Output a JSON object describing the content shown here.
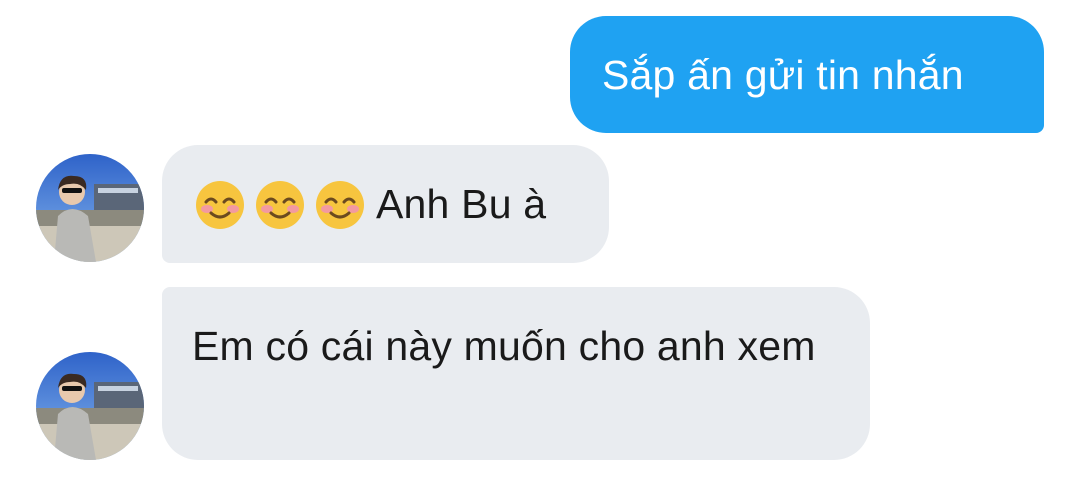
{
  "messages": [
    {
      "direction": "outgoing",
      "text": "Sắp ấn gửi tin nhắn"
    },
    {
      "direction": "incoming",
      "emoji": [
        "smiling-face-with-blush",
        "smiling-face-with-blush",
        "smiling-face-with-blush"
      ],
      "text": "Anh Bu à"
    },
    {
      "direction": "incoming",
      "text": "Em có cái này muốn cho anh xem"
    }
  ],
  "colors": {
    "outgoing_bubble": "#1fa2f2",
    "incoming_bubble": "#e9ecf0",
    "outgoing_text": "#ffffff",
    "incoming_text": "#1a1a1a"
  }
}
